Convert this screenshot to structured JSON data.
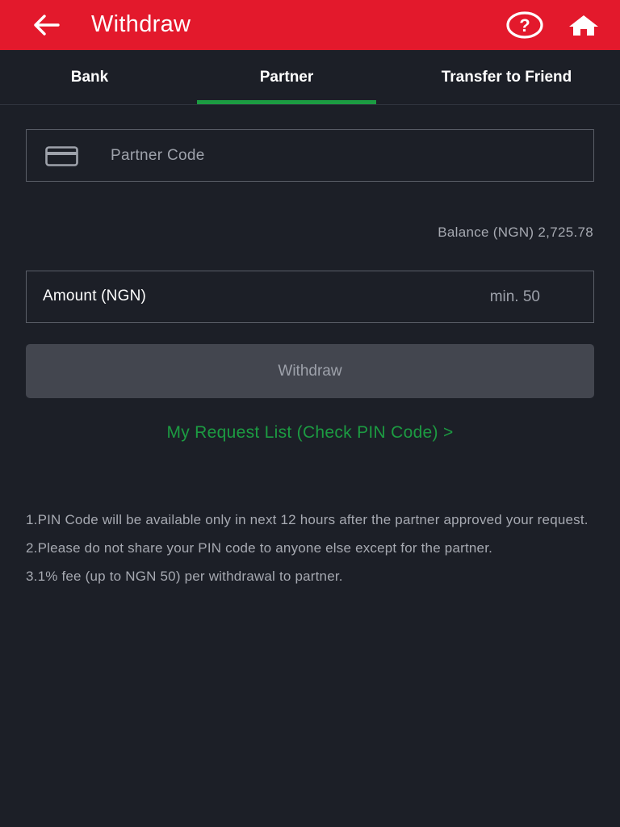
{
  "header": {
    "title": "Withdraw",
    "back_icon": "arrow-left-icon",
    "help_icon": "question-circle-icon",
    "home_icon": "home-icon",
    "background_color": "#e3192c"
  },
  "tabs": [
    {
      "label": "Bank",
      "active": false
    },
    {
      "label": "Partner",
      "active": true
    },
    {
      "label": "Transfer to Friend",
      "active": false
    }
  ],
  "active_tab_color": "#1c9b42",
  "partner_code": {
    "icon": "credit-card-icon",
    "placeholder": "Partner Code",
    "value": ""
  },
  "balance": {
    "label": "Balance (NGN)",
    "value": "2,725.78",
    "text": "Balance (NGN) 2,725.78"
  },
  "amount": {
    "label": "Amount (NGN)",
    "placeholder": "min. 50",
    "value": ""
  },
  "withdraw_button": {
    "label": "Withdraw",
    "enabled": false
  },
  "request_link": {
    "label": "My Request List (Check PIN Code) >"
  },
  "notes": [
    "1.PIN Code will be available only in next 12 hours after the partner approved your request.",
    "2.Please do not share your PIN code to anyone else except for the partner.",
    "3.1% fee (up to NGN 50) per withdrawal to partner."
  ]
}
